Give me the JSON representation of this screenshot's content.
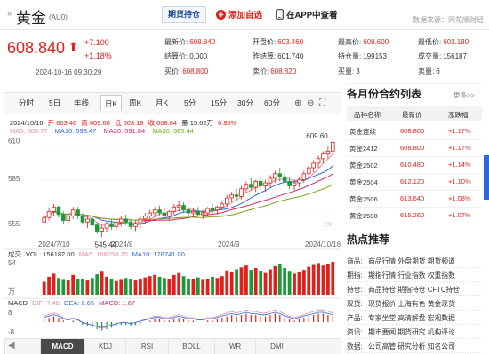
{
  "header": {
    "mark": "»",
    "title": "黄金",
    "code": "(AU0)",
    "futures_btn": "期货持仓",
    "add_btn": "添加自选",
    "app_btn": "在APP中查看",
    "source": "数据来源：同花顺财经"
  },
  "quote": {
    "price": "608.840",
    "change": "+7.100",
    "change_pct": "+1.18%",
    "timestamp": "2024-10-16 09:30:29",
    "fields": [
      {
        "label": "最新价:",
        "value": "608.840",
        "color": "red"
      },
      {
        "label": "开盘价:",
        "value": "603.460",
        "color": "red"
      },
      {
        "label": "最高价:",
        "value": "609.600",
        "color": "red"
      },
      {
        "label": "最低价:",
        "value": "603.180",
        "color": "red"
      },
      {
        "label": "结算价:",
        "value": "0.000",
        "color": "black"
      },
      {
        "label": "昨结算:",
        "value": "601.740",
        "color": "black"
      },
      {
        "label": "持仓量:",
        "value": "199153",
        "color": "black"
      },
      {
        "label": "成交量:",
        "value": "156187",
        "color": "black"
      },
      {
        "label": "买价:",
        "value": "608.800",
        "color": "red"
      },
      {
        "label": "卖价:",
        "value": "608.820",
        "color": "red"
      },
      {
        "label": "买量:",
        "value": "3",
        "color": "black"
      },
      {
        "label": "卖量:",
        "value": "6",
        "color": "black"
      }
    ]
  },
  "chart": {
    "periods": [
      "分时",
      "5日",
      "年线",
      "日K",
      "周K",
      "月K",
      "5分",
      "15分",
      "30分",
      "60分"
    ],
    "active_period": "日K",
    "info": {
      "date": "2024/10/16",
      "open": "开 603.46",
      "high": "高 609.60",
      "low": "低 603.18",
      "close": "收 608.84",
      "vol": "量 15.62万",
      "pct": "0.86%"
    },
    "ma": {
      "ma5": "MA5: 600.77",
      "ma10": "MA10: 598.47",
      "ma20": "MA20: 591.84",
      "ma30": "MA30: 585.44"
    },
    "yaxis": [
      "610",
      "585",
      "555"
    ],
    "xaxis": [
      "2024/7/10",
      "2024/8",
      "2024/9",
      "2024/10/16"
    ],
    "high_label": "609.60",
    "low_label": "545.44",
    "neg_pct": "-1%",
    "vol_line": {
      "title": "成交",
      "vol": "VOL: 156182.00",
      "ma5": "MA5: 168258.20",
      "ma10": "MA10: 178741.00",
      "y_top": "54",
      "y_bot": "万"
    },
    "macd_line": {
      "title": "MACD",
      "dif": "DIF: 7.48",
      "dea": "DEA: 6.65",
      "macd": "MACD: 1.67",
      "y_top": "8",
      "y_bot": "-8"
    },
    "indicators": [
      "",
      "MACD",
      "KDJ",
      "RSI",
      "BOLL",
      "WR",
      "DMI"
    ],
    "active_indicator": "MACD"
  },
  "chart_data": {
    "type": "candlestick",
    "ylim": [
      545,
      612
    ],
    "candles": [
      [
        556,
        560,
        554,
        559
      ],
      [
        559,
        565,
        557,
        563
      ],
      [
        563,
        568,
        560,
        566
      ],
      [
        566,
        567,
        559,
        561
      ],
      [
        561,
        563,
        555,
        557
      ],
      [
        557,
        561,
        554,
        560
      ],
      [
        560,
        566,
        558,
        564
      ],
      [
        564,
        566,
        558,
        560
      ],
      [
        560,
        562,
        555,
        556
      ],
      [
        556,
        560,
        552,
        558
      ],
      [
        558,
        560,
        553,
        554
      ],
      [
        554,
        556,
        548,
        550
      ],
      [
        550,
        554,
        546,
        552
      ],
      [
        552,
        556,
        549,
        555
      ],
      [
        555,
        558,
        551,
        553
      ],
      [
        553,
        557,
        551,
        556
      ],
      [
        556,
        560,
        553,
        558
      ],
      [
        558,
        561,
        554,
        556
      ],
      [
        556,
        558,
        551,
        553
      ],
      [
        553,
        557,
        550,
        555
      ],
      [
        555,
        560,
        552,
        558
      ],
      [
        558,
        562,
        555,
        560
      ],
      [
        560,
        564,
        557,
        562
      ],
      [
        562,
        566,
        559,
        564
      ],
      [
        564,
        567,
        560,
        562
      ],
      [
        562,
        565,
        558,
        560
      ],
      [
        560,
        564,
        557,
        563
      ],
      [
        563,
        568,
        561,
        566
      ],
      [
        566,
        570,
        563,
        567
      ],
      [
        567,
        569,
        562,
        564
      ],
      [
        564,
        566,
        560,
        562
      ],
      [
        562,
        565,
        559,
        563
      ],
      [
        563,
        566,
        560,
        561
      ],
      [
        561,
        564,
        558,
        562
      ],
      [
        562,
        566,
        560,
        565
      ],
      [
        565,
        568,
        562,
        564
      ],
      [
        564,
        567,
        561,
        566
      ],
      [
        566,
        570,
        564,
        568
      ],
      [
        568,
        574,
        566,
        572
      ],
      [
        572,
        576,
        569,
        574
      ],
      [
        574,
        578,
        570,
        573
      ],
      [
        573,
        580,
        571,
        578
      ],
      [
        578,
        583,
        575,
        581
      ],
      [
        581,
        585,
        577,
        579
      ],
      [
        579,
        584,
        576,
        583
      ],
      [
        583,
        586,
        578,
        580
      ],
      [
        580,
        584,
        576,
        582
      ],
      [
        582,
        587,
        579,
        585
      ],
      [
        585,
        590,
        582,
        588
      ],
      [
        588,
        592,
        583,
        586
      ],
      [
        586,
        589,
        580,
        583
      ],
      [
        583,
        586,
        578,
        580
      ],
      [
        580,
        584,
        577,
        582
      ],
      [
        582,
        586,
        579,
        584
      ],
      [
        584,
        590,
        582,
        588
      ],
      [
        588,
        594,
        585,
        592
      ],
      [
        592,
        597,
        589,
        595
      ],
      [
        595,
        600,
        592,
        598
      ],
      [
        598,
        603,
        595,
        601
      ],
      [
        601,
        606,
        598,
        603
      ],
      [
        603,
        609.6,
        601,
        608.84
      ]
    ],
    "volumes": [
      22,
      30,
      35,
      28,
      25,
      24,
      33,
      27,
      26,
      24,
      28,
      34,
      38,
      30,
      26,
      23,
      25,
      28,
      27,
      24,
      26,
      29,
      31,
      33,
      30,
      28,
      27,
      33,
      36,
      31,
      27,
      26,
      29,
      25,
      27,
      30,
      28,
      31,
      40,
      37,
      42,
      45,
      48,
      41,
      44,
      39,
      36,
      42,
      47,
      50,
      44,
      38,
      35,
      37,
      41,
      46,
      49,
      52,
      48,
      51,
      54
    ],
    "vol_up": [
      1,
      1,
      1,
      0,
      0,
      1,
      1,
      0,
      0,
      1,
      0,
      0,
      1,
      1,
      0,
      1,
      1,
      0,
      0,
      1,
      1,
      1,
      1,
      1,
      0,
      0,
      1,
      1,
      1,
      0,
      0,
      1,
      0,
      1,
      1,
      0,
      1,
      1,
      1,
      1,
      0,
      1,
      1,
      0,
      1,
      0,
      1,
      1,
      1,
      0,
      0,
      0,
      1,
      1,
      1,
      1,
      1,
      1,
      1,
      1,
      1
    ],
    "macd": [
      2,
      3,
      4,
      3,
      1,
      0,
      1,
      0,
      -2,
      -3,
      -4,
      -5,
      -6,
      -5,
      -4,
      -3,
      -2,
      -2,
      -3,
      -2,
      -1,
      0,
      1,
      2,
      2,
      1,
      1,
      2,
      3,
      2,
      1,
      1,
      0,
      0,
      1,
      1,
      2,
      3,
      4,
      5,
      4,
      5,
      6,
      5,
      5,
      4,
      4,
      5,
      6,
      5,
      3,
      2,
      1,
      2,
      3,
      4,
      5,
      6,
      6,
      5,
      4
    ]
  },
  "contracts": {
    "title": "各月份合约列表",
    "more": "更多>>",
    "headers": [
      "品种名称",
      "最新价",
      "涨跌幅"
    ],
    "rows": [
      {
        "name": "黄金连续",
        "price": "608.800",
        "pct": "+1.17%"
      },
      {
        "name": "黄金2412",
        "price": "608.800",
        "pct": "+1.17%"
      },
      {
        "name": "黄金2502",
        "price": "610.480",
        "pct": "+1.14%"
      },
      {
        "name": "黄金2504",
        "price": "612.120",
        "pct": "+1.10%"
      },
      {
        "name": "黄金2506",
        "price": "613.640",
        "pct": "+1.08%"
      },
      {
        "name": "黄金2508",
        "price": "615.260",
        "pct": "+1.07%"
      }
    ]
  },
  "hot": {
    "title": "热点推荐",
    "rows": [
      {
        "label": "商品:",
        "items": "商品行情 外盘期货 期货频道"
      },
      {
        "label": "期指:",
        "items": "期指行情 行业指数 权重指数"
      },
      {
        "label": "持仓:",
        "items": "商品持仓 期指持仓 CFTC持仓"
      },
      {
        "label": "现货:",
        "items": "现货报价 上海有色 黄金现货"
      },
      {
        "label": "产品:",
        "items": "专家坐堂 高清解盘 宏观数据"
      },
      {
        "label": "资讯:",
        "items": "期市要闻 期货研究 机构评论"
      },
      {
        "label": "数据:",
        "items": "公司高管 研究分析 知名公司"
      }
    ]
  }
}
